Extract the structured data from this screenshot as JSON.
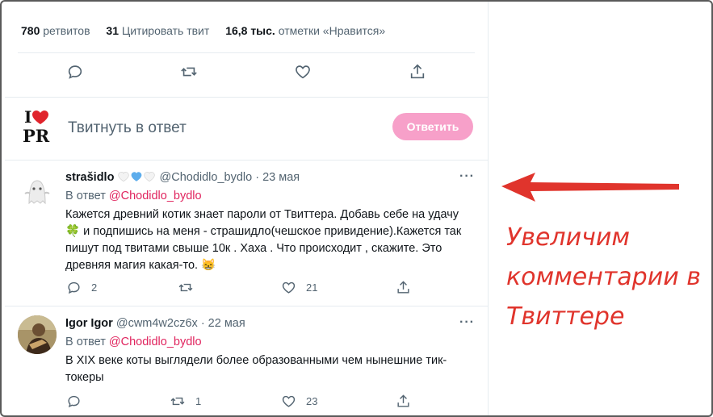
{
  "stats": {
    "retweets_count": "780",
    "retweets_label": "ретвитов",
    "quotes_count": "31",
    "quotes_label": "Цитировать твит",
    "likes_count": "16,8 тыс.",
    "likes_label": "отметки «Нравится»"
  },
  "reply_box": {
    "placeholder": "Твитнуть в ответ",
    "button_label": "Ответить",
    "button_color": "#f7a0c9"
  },
  "tweets": [
    {
      "name": "strašidlo",
      "badges": [
        "white-heart-icon",
        "blue-heart-icon",
        "white-heart-icon"
      ],
      "handle": "@Chodidlo_bydlo",
      "date": "· 23 мая",
      "reply_to_prefix": "В ответ",
      "reply_to": "@Chodidlo_bydlo",
      "text_1": "Кажется древний  котик знает пароли от Твиттера. Добавь себе на удачу",
      "text_2": "🍀 и подпишись на меня - страшидло(чешское привидение).Кажется так",
      "text_3": "пишут  под твитами свыше 10к . Хаха . Что происходит , скажите.  Это",
      "text_4": "древняя магия какая-то. 😸",
      "replies": "2",
      "retweets": "",
      "likes": "21"
    },
    {
      "name": "Igor Igor",
      "handle": "@cwm4w2cz6x",
      "date": "· 22 мая",
      "reply_to_prefix": "В ответ",
      "reply_to": "@Chodidlo_bydlo",
      "text_1": "В XIX веке коты выглядели более образованными чем нынешние тик-",
      "text_2": "токеры",
      "replies": "",
      "retweets": "1",
      "likes": "23"
    }
  ],
  "annotation": {
    "line_1": "Увеличим",
    "line_2": "комментарии в",
    "line_3": "Твиттере",
    "color": "#e0342c"
  }
}
